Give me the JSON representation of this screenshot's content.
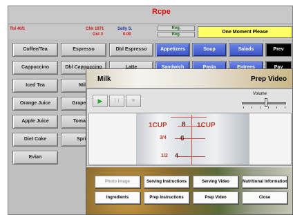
{
  "header": {
    "title": "Rcpe",
    "table": "Tbl 40/1",
    "check": "Chk 1971",
    "guest": "Gst 3",
    "server": "Sally S.",
    "amount": "0.00",
    "reg1": "Reg.",
    "reg2": "Reg.",
    "status": "One Moment Please"
  },
  "items": {
    "col1": [
      "Coffee/Tea",
      "Cappuccino",
      "Iced Tea",
      "Orange Juice",
      "Apple Juice",
      "Diet Coke",
      "Evian"
    ],
    "col2": [
      "Espresso",
      "Dbl Cappuccino",
      "Milk",
      "Grapefruit",
      "Tomato J",
      "Sprite"
    ],
    "col3": [
      "Dbl Espresso",
      "Latte"
    ]
  },
  "categories": {
    "row1": [
      "Appetizers",
      "Soup",
      "Salads"
    ],
    "row2": [
      "Sandwich",
      "Pasta",
      "Entrees"
    ]
  },
  "nav": {
    "prev": "Prev",
    "pay": "Pay"
  },
  "popup": {
    "item": "Milk",
    "title": "Prep Video",
    "controls": {
      "play": "▶",
      "pause": "❙❙",
      "stop": "■",
      "volume_label": "Volume",
      "volume_level": 0.55
    },
    "video": {
      "label_left": "1CUP",
      "label_right": "1CUP",
      "mark_8": "8",
      "mark_6": "6",
      "mark_4": "4",
      "frac_34": "3/4",
      "frac_12": "1/2"
    },
    "actions": {
      "photo_image": "Photo Image",
      "serving_instructions": "Serving Instructions",
      "serving_video": "Serving Video",
      "nutritional_information": "Nutritional Information",
      "ingredients": "Ingredients",
      "prep_instructions": "Prep Instructions",
      "prep_video": "Prep Video",
      "close": "Close"
    }
  },
  "colors": {
    "category_blue": "#3a52c4",
    "status_yellow": "#ffff66",
    "title_red": "#e01010"
  }
}
